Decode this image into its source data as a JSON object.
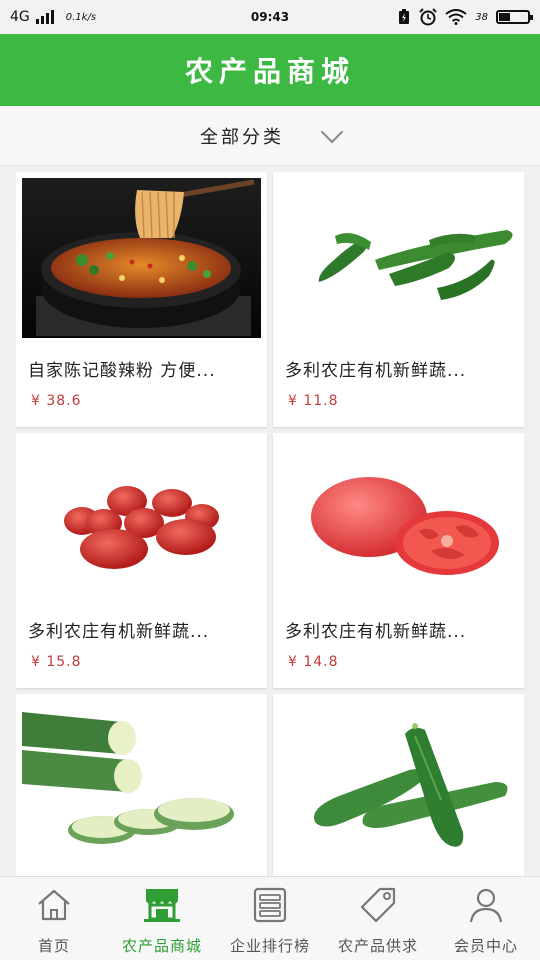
{
  "status_bar": {
    "network": "4G",
    "speed": "0.1k/s",
    "time": "09:43",
    "battery_pct": "38",
    "battery_level": 0.38
  },
  "header": {
    "title": "农产品商城"
  },
  "filter": {
    "label": "全部分类",
    "icon": "chevron-down-icon"
  },
  "products": [
    {
      "name": "自家陈记酸辣粉 方便...",
      "price": "¥ 38.6",
      "image": "hot-sour-noodles-image"
    },
    {
      "name": "多利农庄有机新鲜蔬...",
      "price": "¥ 11.8",
      "image": "green-peppers-image"
    },
    {
      "name": "多利农庄有机新鲜蔬...",
      "price": "¥ 15.8",
      "image": "cherry-tomatoes-image"
    },
    {
      "name": "多利农庄有机新鲜蔬...",
      "price": "¥ 14.8",
      "image": "tomatoes-image"
    },
    {
      "name": "",
      "price": "",
      "image": "luffa-image"
    },
    {
      "name": "",
      "price": "",
      "image": "cucumbers-image"
    }
  ],
  "tabs": [
    {
      "label": "首页",
      "icon": "home-icon",
      "active": false
    },
    {
      "label": "农产品商城",
      "icon": "store-icon",
      "active": true
    },
    {
      "label": "企业排行榜",
      "icon": "list-icon",
      "active": false
    },
    {
      "label": "农产品供求",
      "icon": "tag-icon",
      "active": false
    },
    {
      "label": "会员中心",
      "icon": "user-icon",
      "active": false
    }
  ],
  "colors": {
    "brand_green": "#3db943",
    "active_tab": "#2e9e35",
    "price_red": "#c53a3a"
  }
}
